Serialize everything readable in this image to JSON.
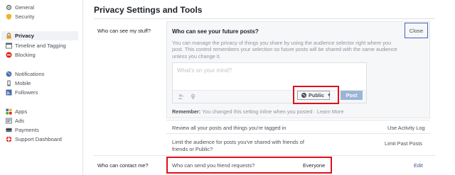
{
  "sidebar": {
    "items": [
      {
        "label": "General",
        "icon": "gear-icon"
      },
      {
        "label": "Security",
        "icon": "shield-icon"
      },
      {
        "label": "Privacy",
        "icon": "lock-icon"
      },
      {
        "label": "Timeline and Tagging",
        "icon": "timeline-icon"
      },
      {
        "label": "Blocking",
        "icon": "block-icon"
      },
      {
        "label": "Notifications",
        "icon": "globe-icon"
      },
      {
        "label": "Mobile",
        "icon": "mobile-icon"
      },
      {
        "label": "Followers",
        "icon": "rss-icon"
      },
      {
        "label": "Apps",
        "icon": "apps-icon"
      },
      {
        "label": "Ads",
        "icon": "ads-icon"
      },
      {
        "label": "Payments",
        "icon": "card-icon"
      },
      {
        "label": "Support Dashboard",
        "icon": "lifebuoy-icon"
      }
    ]
  },
  "page": {
    "title": "Privacy Settings and Tools"
  },
  "stuff": {
    "label": "Who can see my stuff?",
    "panel_title": "Who can see your future posts?",
    "description": "You can manage the privacy of things you share by using the audience selector right where you post. This control remembers your selection so future posts will be shared with the same audience unless you change it.",
    "close_label": "Close",
    "composer_placeholder": "What's on your mind?",
    "audience_label": "Public",
    "post_label": "Post",
    "remember_label": "Remember:",
    "remember_text": "You changed this setting inline when you posted · Learn More",
    "review_text": "Review all your posts and things you're tagged in",
    "review_link": "Use Activity Log",
    "limit_text": "Limit the audience for posts you've shared with friends of friends or Public?",
    "limit_link": "Limit Past Posts"
  },
  "contact": {
    "label": "Who can contact me?",
    "question": "Who can send you friend requests?",
    "value": "Everyone",
    "edit_label": "Edit"
  },
  "colors": {
    "highlight": "#e0101b",
    "link": "#365899",
    "button_blue": "#4267b2"
  }
}
